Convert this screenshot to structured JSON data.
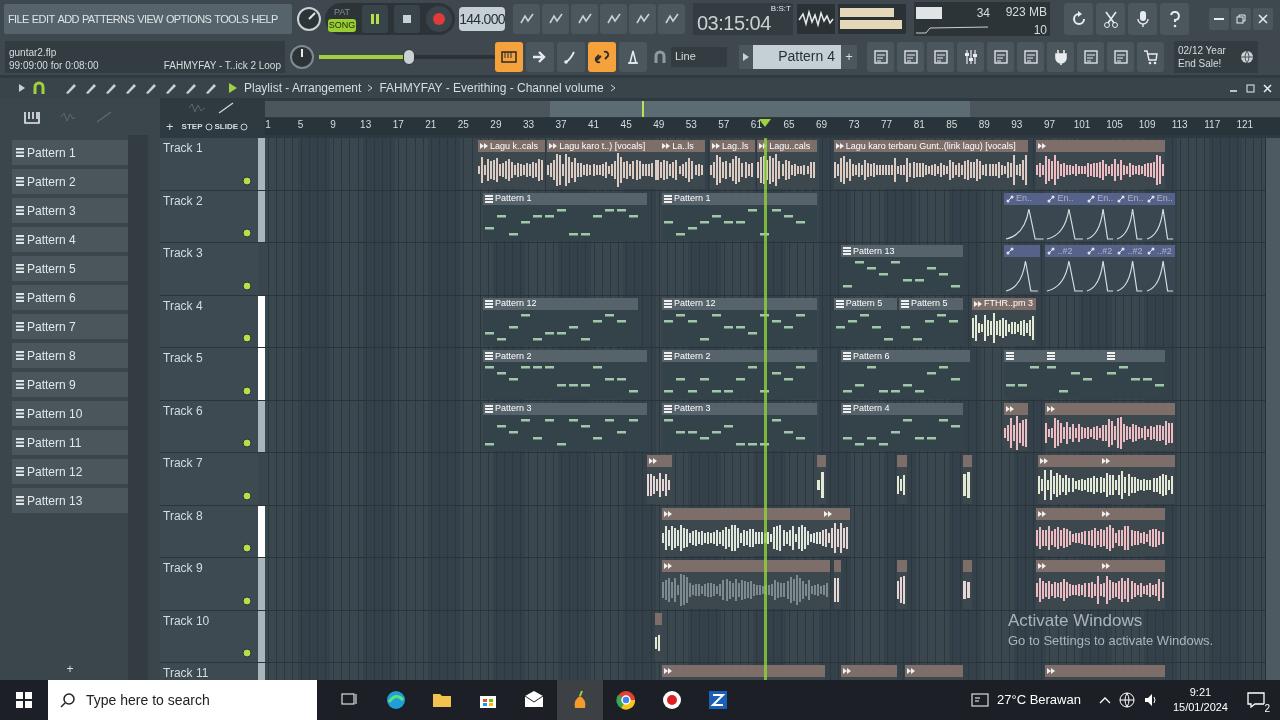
{
  "menu": [
    "FILE",
    "EDIT",
    "ADD",
    "PATTERNS",
    "VIEW",
    "OPTIONS",
    "TOOLS",
    "HELP"
  ],
  "transport": {
    "modes": [
      {
        "label": "PAT",
        "selected": false
      },
      {
        "label": "SONG",
        "selected": true
      }
    ],
    "playing": true,
    "tempo": "144.000",
    "time": "03:15:04",
    "time_format": "B:S:T"
  },
  "cpu": {
    "value": "34",
    "memory": "923 MB",
    "polyphony": "10"
  },
  "project": {
    "file": "guntar2.flp",
    "hint": "99:09:00 for 0:08:00",
    "message": "FAHMYFAY - T..ick 2 Loop"
  },
  "master_volume": {
    "level": 0.51
  },
  "toggles": [
    {
      "on": true
    },
    {
      "on": false
    },
    {
      "on": false
    },
    {
      "on": true
    },
    {
      "on": false
    }
  ],
  "snap": "Line",
  "current_pattern": "Pattern 4",
  "news": {
    "line1": "02/12 Year",
    "line2": "End Sale!"
  },
  "playlist": {
    "title": "Playlist - Arrangement",
    "path": "FAHMYFAY - Everithing - Channel volume",
    "step_label": "STEP",
    "slide_label": "SLIDE",
    "add": "+"
  },
  "ruler": [
    "1",
    "5",
    "9",
    "13",
    "17",
    "21",
    "25",
    "29",
    "33",
    "37",
    "41",
    "45",
    "49",
    "53",
    "57",
    "61",
    "65",
    "69",
    "73",
    "77",
    "81",
    "85",
    "89",
    "93",
    "97",
    "101",
    "105",
    "109",
    "113",
    "117",
    "121"
  ],
  "patterns": [
    {
      "name": "Pattern 1"
    },
    {
      "name": "Pattern 2"
    },
    {
      "name": "Pattern 3"
    },
    {
      "name": "Pattern 4"
    },
    {
      "name": "Pattern 5"
    },
    {
      "name": "Pattern 6"
    },
    {
      "name": "Pattern 7"
    },
    {
      "name": "Pattern 8"
    },
    {
      "name": "Pattern 9"
    },
    {
      "name": "Pattern 10"
    },
    {
      "name": "Pattern 11"
    },
    {
      "name": "Pattern 12"
    },
    {
      "name": "Pattern 13"
    }
  ],
  "pattern_add": "+",
  "tracks": [
    {
      "name": "Track 1",
      "color": "#a9b4bb",
      "on": true,
      "clips": [
        {
          "kind": "audio",
          "label": "Lagu k..cals",
          "color": "#dccbc2"
        },
        {
          "kind": "audio",
          "label": "Lagu karo t..) [vocals]",
          "color": "#dccbc2"
        },
        {
          "kind": "audio",
          "color": "#dccbc2"
        },
        {
          "kind": "audio",
          "label": "La..ls",
          "color": "#dccbc2"
        },
        {
          "kind": "audio",
          "label": "Lag..ls",
          "color": "#dccbc2"
        },
        {
          "kind": "audio",
          "label": "Lagu..cals",
          "color": "#dccbc2"
        },
        {
          "kind": "audio",
          "label": "Lagu karo terbaru Gunt..(lirik lagu) [vocals]",
          "color": "#dccbc2"
        },
        {
          "kind": "audio",
          "color": "#ecbcc2"
        }
      ]
    },
    {
      "name": "Track 2",
      "color": "#a9b4bb",
      "on": true,
      "clips": [
        {
          "kind": "pattern",
          "label": "Pattern 1"
        },
        {
          "kind": "pattern",
          "label": "Pattern 1"
        },
        {
          "kind": "automation",
          "label": "En.."
        },
        {
          "kind": "automation",
          "label": "En.."
        },
        {
          "kind": "automation",
          "label": "En.."
        },
        {
          "kind": "automation",
          "label": "En.."
        },
        {
          "kind": "automation",
          "label": "En.."
        }
      ]
    },
    {
      "name": "Track 3",
      "color": "#3a464d",
      "on": true,
      "clips": [
        {
          "kind": "pattern",
          "label": "Pattern 13"
        },
        {
          "kind": "automation"
        },
        {
          "kind": "automation",
          "label": "..#2"
        },
        {
          "kind": "automation",
          "label": "..#2"
        },
        {
          "kind": "automation",
          "label": "..#2"
        },
        {
          "kind": "automation",
          "label": "..#2"
        }
      ]
    },
    {
      "name": "Track 4",
      "color": "#ffffff",
      "on": true,
      "clips": [
        {
          "kind": "pattern",
          "label": "Pattern 12"
        },
        {
          "kind": "pattern",
          "label": "Pattern 12"
        },
        {
          "kind": "pattern",
          "label": "Pattern 5"
        },
        {
          "kind": "pattern",
          "label": "Pattern 5"
        },
        {
          "kind": "audio",
          "label": "FTHR..pm 3",
          "color": "#e2ead6"
        }
      ]
    },
    {
      "name": "Track 5",
      "color": "#ffffff",
      "on": true,
      "clips": [
        {
          "kind": "pattern",
          "label": "Pattern 2"
        },
        {
          "kind": "pattern",
          "label": "Pattern 2"
        },
        {
          "kind": "pattern",
          "label": "Pattern 6"
        },
        {
          "kind": "pattern"
        },
        {
          "kind": "pattern"
        },
        {
          "kind": "pattern"
        }
      ]
    },
    {
      "name": "Track 6",
      "color": "#a9b4bb",
      "on": true,
      "clips": [
        {
          "kind": "pattern",
          "label": "Pattern 3"
        },
        {
          "kind": "pattern",
          "label": "Pattern 3"
        },
        {
          "kind": "pattern",
          "label": "Pattern 4"
        },
        {
          "kind": "audio",
          "color": "#ecbcc2"
        },
        {
          "kind": "audio",
          "color": "#ecbcc2"
        }
      ]
    },
    {
      "name": "Track 7",
      "color": "#3a464d",
      "on": true,
      "clips": [
        {
          "kind": "audio",
          "color": "#e6d6d6"
        },
        {
          "kind": "audio",
          "color": "#e2ead6"
        },
        {
          "kind": "audio",
          "color": "#e2ead6"
        },
        {
          "kind": "audio",
          "color": "#e2ead6"
        },
        {
          "kind": "audio",
          "color": "#e2ead6"
        },
        {
          "kind": "audio",
          "color": "#e2ead6"
        }
      ]
    },
    {
      "name": "Track 8",
      "color": "#ffffff",
      "on": true,
      "clips": [
        {
          "kind": "audio",
          "color": "#dfe6dc"
        },
        {
          "kind": "audio",
          "color": "#e6d6d6"
        },
        {
          "kind": "audio",
          "color": "#ecbcc2"
        },
        {
          "kind": "audio",
          "color": "#ecbcc2"
        }
      ]
    },
    {
      "name": "Track 9",
      "color": "#a9b4bb",
      "on": true,
      "clips": [
        {
          "kind": "audio",
          "color": "#7d8a8e"
        },
        {
          "kind": "audio",
          "color": "#e6d6d6"
        },
        {
          "kind": "audio",
          "color": "#e6d6d6"
        },
        {
          "kind": "audio",
          "color": "#e6d6d6"
        },
        {
          "kind": "audio",
          "color": "#ecbcc2"
        },
        {
          "kind": "audio",
          "color": "#ecbcc2"
        }
      ]
    },
    {
      "name": "Track 10",
      "color": "#a9b4bb",
      "on": true,
      "clips": [
        {
          "kind": "audio",
          "color": "#e2ead6"
        }
      ]
    },
    {
      "name": "Track 11",
      "color": "#a9b4bb",
      "clips": [
        {
          "kind": "audio"
        },
        {
          "kind": "audio"
        },
        {
          "kind": "audio"
        },
        {
          "kind": "audio"
        }
      ]
    }
  ],
  "taskbar": {
    "search_placeholder": "Type here to search",
    "weather": "27°C Berawan",
    "time": "9:21",
    "date": "15/01/2024",
    "notifications": "2"
  },
  "activation": {
    "title": "Activate Windows",
    "text": "Go to Settings to activate Windows."
  }
}
